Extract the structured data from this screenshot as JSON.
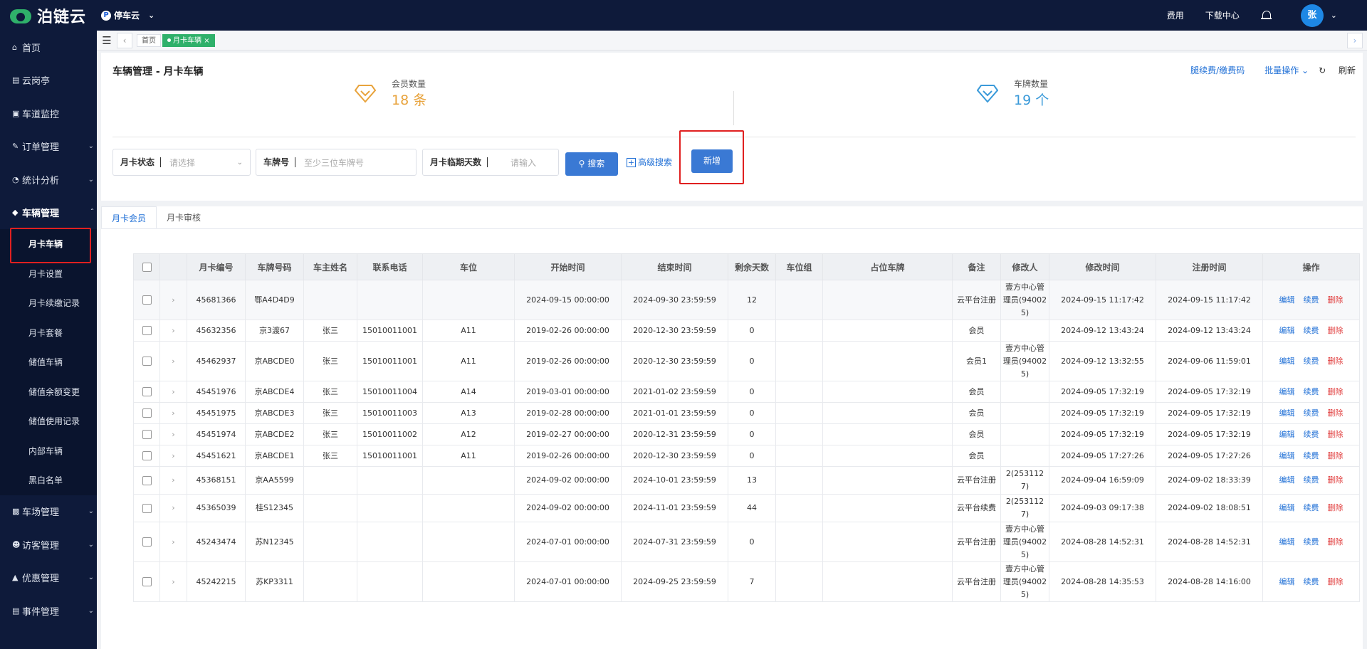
{
  "top": {
    "logo_text": "泊链云",
    "app_name": "停车云",
    "links": [
      "费用",
      "下载中心"
    ],
    "avatar": "张"
  },
  "sidebar": {
    "items": [
      {
        "label": "首页",
        "icon": "home-icon"
      },
      {
        "label": "云岗亭",
        "icon": "booth-icon"
      },
      {
        "label": "车道监控",
        "icon": "monitor-icon"
      },
      {
        "label": "订单管理",
        "icon": "order-icon"
      },
      {
        "label": "统计分析",
        "icon": "chart-icon"
      },
      {
        "label": "车辆管理",
        "icon": "car-icon"
      },
      {
        "label": "车场管理",
        "icon": "parking-icon"
      },
      {
        "label": "访客管理",
        "icon": "visitor-icon"
      },
      {
        "label": "优惠管理",
        "icon": "coupon-icon"
      },
      {
        "label": "事件管理",
        "icon": "event-icon"
      }
    ],
    "sub_items": [
      "月卡车辆",
      "月卡设置",
      "月卡续缴记录",
      "月卡套餐",
      "储值车辆",
      "储值余额变更",
      "储值使用记录",
      "内部车辆",
      "黑白名单"
    ]
  },
  "tabs": {
    "home": "首页",
    "active": "月卡车辆",
    "close": "×"
  },
  "header": {
    "title": "车辆管理 - 月卡车辆",
    "link_qrcode": "腿续费/缴费码",
    "link_batch": "批量操作",
    "link_refresh": "刷新",
    "member_label": "会员数量",
    "member_value": "18 条",
    "plate_label": "车牌数量",
    "plate_value": "19 个",
    "member_color": "#e8a33c",
    "plate_color": "#3a9ad9"
  },
  "filters": {
    "status_label": "月卡状态",
    "status_placeholder": "请选择",
    "plate_label": "车牌号",
    "plate_placeholder": "至少三位车牌号",
    "days_label": "月卡临期天数",
    "days_placeholder": "请输入",
    "search_btn": "搜索",
    "advanced": "高级搜索",
    "add_btn": "新增"
  },
  "content_tabs": [
    "月卡会员",
    "月卡审核"
  ],
  "table": {
    "headers": [
      "月卡编号",
      "车牌号码",
      "车主姓名",
      "联系电话",
      "车位",
      "开始时间",
      "结束时间",
      "剩余天数",
      "车位组",
      "占位车牌",
      "备注",
      "修改人",
      "修改时间",
      "注册时间",
      "操作"
    ],
    "ops": [
      "编辑",
      "续费",
      "删除"
    ],
    "rows": [
      {
        "id": "45681366",
        "plate": "鄂A4D4D9",
        "owner": "",
        "phone": "",
        "space": "",
        "start": "2024-09-15 00:00:00",
        "end": "2024-09-30 23:59:59",
        "days": "12",
        "group": "",
        "occupy": "",
        "note": "云平台注册",
        "editor": "壹方中心管理员(940025)",
        "mtime": "2024-09-15 11:17:42",
        "rtime": "2024-09-15 11:17:42"
      },
      {
        "id": "45632356",
        "plate": "京3渡67",
        "owner": "张三",
        "phone": "15010011001",
        "space": "A11",
        "start": "2019-02-26 00:00:00",
        "end": "2020-12-30 23:59:59",
        "days": "0",
        "group": "",
        "occupy": "",
        "note": "会员",
        "editor": "",
        "mtime": "2024-09-12 13:43:24",
        "rtime": "2024-09-12 13:43:24"
      },
      {
        "id": "45462937",
        "plate": "京ABCDE0",
        "owner": "张三",
        "phone": "15010011001",
        "space": "A11",
        "start": "2019-02-26 00:00:00",
        "end": "2020-12-30 23:59:59",
        "days": "0",
        "group": "",
        "occupy": "",
        "note": "会员1",
        "editor": "壹方中心管理员(940025)",
        "mtime": "2024-09-12 13:32:55",
        "rtime": "2024-09-06 11:59:01"
      },
      {
        "id": "45451976",
        "plate": "京ABCDE4",
        "owner": "张三",
        "phone": "15010011004",
        "space": "A14",
        "start": "2019-03-01 00:00:00",
        "end": "2021-01-02 23:59:59",
        "days": "0",
        "group": "",
        "occupy": "",
        "note": "会员",
        "editor": "",
        "mtime": "2024-09-05 17:32:19",
        "rtime": "2024-09-05 17:32:19"
      },
      {
        "id": "45451975",
        "plate": "京ABCDE3",
        "owner": "张三",
        "phone": "15010011003",
        "space": "A13",
        "start": "2019-02-28 00:00:00",
        "end": "2021-01-01 23:59:59",
        "days": "0",
        "group": "",
        "occupy": "",
        "note": "会员",
        "editor": "",
        "mtime": "2024-09-05 17:32:19",
        "rtime": "2024-09-05 17:32:19"
      },
      {
        "id": "45451974",
        "plate": "京ABCDE2",
        "owner": "张三",
        "phone": "15010011002",
        "space": "A12",
        "start": "2019-02-27 00:00:00",
        "end": "2020-12-31 23:59:59",
        "days": "0",
        "group": "",
        "occupy": "",
        "note": "会员",
        "editor": "",
        "mtime": "2024-09-05 17:32:19",
        "rtime": "2024-09-05 17:32:19"
      },
      {
        "id": "45451621",
        "plate": "京ABCDE1",
        "owner": "张三",
        "phone": "15010011001",
        "space": "A11",
        "start": "2019-02-26 00:00:00",
        "end": "2020-12-30 23:59:59",
        "days": "0",
        "group": "",
        "occupy": "",
        "note": "会员",
        "editor": "",
        "mtime": "2024-09-05 17:27:26",
        "rtime": "2024-09-05 17:27:26"
      },
      {
        "id": "45368151",
        "plate": "京AA5599",
        "owner": "",
        "phone": "",
        "space": "",
        "start": "2024-09-02 00:00:00",
        "end": "2024-10-01 23:59:59",
        "days": "13",
        "group": "",
        "occupy": "",
        "note": "云平台注册",
        "editor": "2(2531127)",
        "mtime": "2024-09-04 16:59:09",
        "rtime": "2024-09-02 18:33:39"
      },
      {
        "id": "45365039",
        "plate": "桂S12345",
        "owner": "",
        "phone": "",
        "space": "",
        "start": "2024-09-02 00:00:00",
        "end": "2024-11-01 23:59:59",
        "days": "44",
        "group": "",
        "occupy": "",
        "note": "云平台续费",
        "editor": "2(2531127)",
        "mtime": "2024-09-03 09:17:38",
        "rtime": "2024-09-02 18:08:51"
      },
      {
        "id": "45243474",
        "plate": "苏N12345",
        "owner": "",
        "phone": "",
        "space": "",
        "start": "2024-07-01 00:00:00",
        "end": "2024-07-31 23:59:59",
        "days": "0",
        "group": "",
        "occupy": "",
        "note": "云平台注册",
        "editor": "壹方中心管理员(940025)",
        "mtime": "2024-08-28 14:52:31",
        "rtime": "2024-08-28 14:52:31"
      },
      {
        "id": "45242215",
        "plate": "苏KP3311",
        "owner": "",
        "phone": "",
        "space": "",
        "start": "2024-07-01 00:00:00",
        "end": "2024-09-25 23:59:59",
        "days": "7",
        "group": "",
        "occupy": "",
        "note": "云平台注册",
        "editor": "壹方中心管理员(940025)",
        "mtime": "2024-08-28 14:35:53",
        "rtime": "2024-08-28 14:16:00"
      }
    ]
  }
}
